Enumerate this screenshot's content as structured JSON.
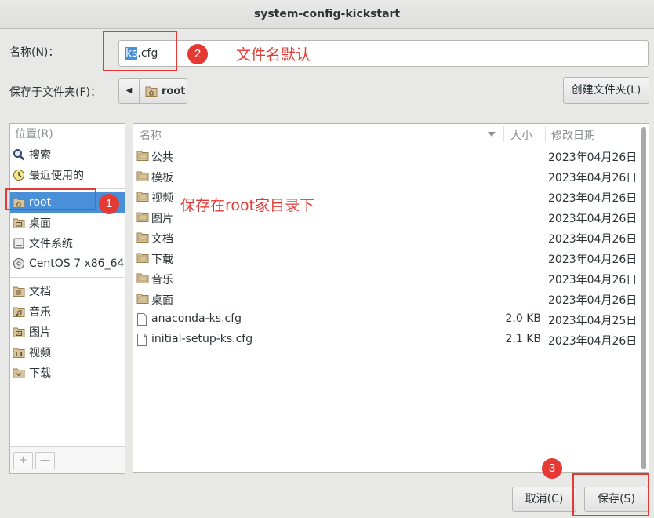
{
  "window": {
    "title": "system-config-kickstart"
  },
  "name_row": {
    "label": "名称(N)：",
    "value_selected": "ks",
    "value_rest": ".cfg"
  },
  "folder_row": {
    "label": "保存于文件夹(F)：",
    "current": "root",
    "create_folder": "创建文件夹(L)"
  },
  "places": {
    "header": "位置(R)",
    "group1": [
      {
        "label": "搜索",
        "icon": "search-icon"
      },
      {
        "label": "最近使用的",
        "icon": "recent-icon"
      }
    ],
    "group2": [
      {
        "label": "root",
        "icon": "home-folder-icon",
        "active": true
      },
      {
        "label": "桌面",
        "icon": "desktop-folder-icon"
      },
      {
        "label": "文件系统",
        "icon": "drive-icon"
      },
      {
        "label": "CentOS 7 x86_64",
        "icon": "disc-icon"
      }
    ],
    "group3": [
      {
        "label": "文档",
        "icon": "folder-documents-icon"
      },
      {
        "label": "音乐",
        "icon": "folder-music-icon"
      },
      {
        "label": "图片",
        "icon": "folder-pictures-icon"
      },
      {
        "label": "视频",
        "icon": "folder-videos-icon"
      },
      {
        "label": "下载",
        "icon": "folder-download-icon"
      }
    ],
    "add_label": "+",
    "remove_label": "—"
  },
  "files": {
    "columns": {
      "name": "名称",
      "size": "大小",
      "date": "修改日期"
    },
    "rows": [
      {
        "name": "公共",
        "size": "",
        "date": "2023年04月26日",
        "icon": "folder-icon"
      },
      {
        "name": "模板",
        "size": "",
        "date": "2023年04月26日",
        "icon": "folder-icon"
      },
      {
        "name": "视频",
        "size": "",
        "date": "2023年04月26日",
        "icon": "folder-icon"
      },
      {
        "name": "图片",
        "size": "",
        "date": "2023年04月26日",
        "icon": "folder-icon"
      },
      {
        "name": "文档",
        "size": "",
        "date": "2023年04月26日",
        "icon": "folder-icon"
      },
      {
        "name": "下载",
        "size": "",
        "date": "2023年04月26日",
        "icon": "folder-icon"
      },
      {
        "name": "音乐",
        "size": "",
        "date": "2023年04月26日",
        "icon": "folder-icon"
      },
      {
        "name": "桌面",
        "size": "",
        "date": "2023年04月26日",
        "icon": "folder-icon"
      },
      {
        "name": "anaconda-ks.cfg",
        "size": "2.0 KB",
        "date": "2023年04月25日",
        "icon": "file-icon"
      },
      {
        "name": "initial-setup-ks.cfg",
        "size": "2.1 KB",
        "date": "2023年04月26日",
        "icon": "file-icon"
      }
    ]
  },
  "buttons": {
    "cancel": "取消(C)",
    "save": "保存(S)"
  },
  "annotations": {
    "badge1": "1",
    "badge2": "2",
    "badge3": "3",
    "note_filename": "文件名默认",
    "note_root": "保存在root家目录下"
  },
  "colors": {
    "accent": "#4a90d9",
    "annotation": "#e53935",
    "folder": "#c9a96e"
  }
}
